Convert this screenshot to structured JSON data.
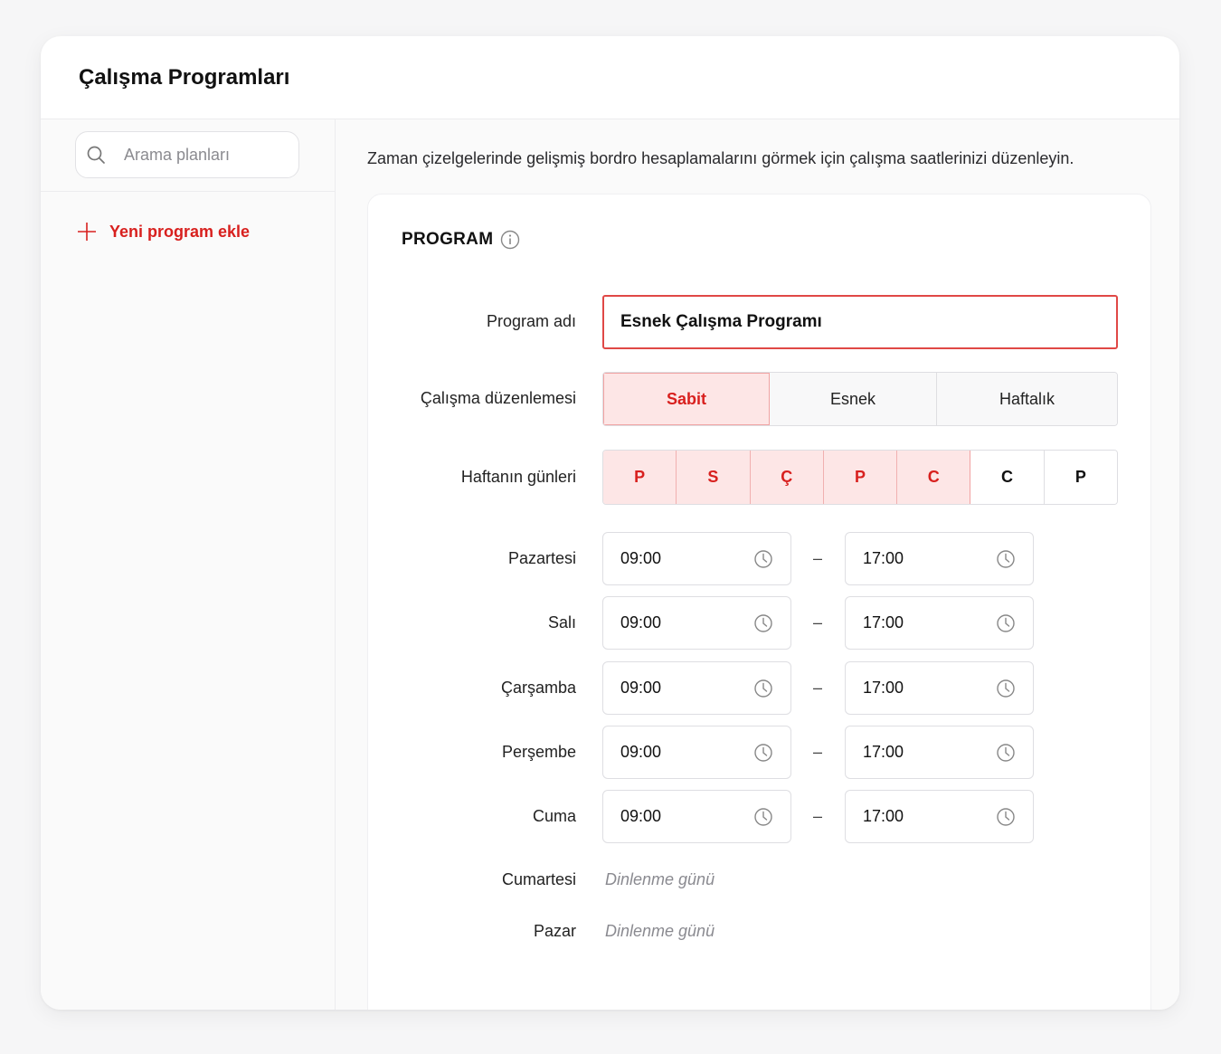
{
  "page": {
    "title": "Çalışma Programları"
  },
  "sidebar": {
    "search": {
      "placeholder": "Arama planları",
      "icon": "search-icon"
    },
    "add_program": {
      "label": "Yeni program ekle",
      "icon": "plus-icon"
    }
  },
  "main": {
    "description": "Zaman çizelgelerinde gelişmiş bordro hesaplamalarını görmek için çalışma saatlerinizi düzenleyin.",
    "section_title": "PROGRAM",
    "program_name": {
      "label": "Program adı",
      "value": "Esnek Çalışma Programı"
    },
    "arrangement": {
      "label": "Çalışma düzenlemesi",
      "options": [
        "Sabit",
        "Esnek",
        "Haftalık"
      ],
      "selected": "Sabit"
    },
    "weekdays": {
      "label": "Haftanın günleri",
      "days": [
        "P",
        "S",
        "Ç",
        "P",
        "C",
        "C",
        "P"
      ],
      "selected_count": 5
    },
    "schedule": [
      {
        "day": "Pazartesi",
        "start": "09:00",
        "end": "17:00"
      },
      {
        "day": "Salı",
        "start": "09:00",
        "end": "17:00"
      },
      {
        "day": "Çarşamba",
        "start": "09:00",
        "end": "17:00"
      },
      {
        "day": "Perşembe",
        "start": "09:00",
        "end": "17:00"
      },
      {
        "day": "Cuma",
        "start": "09:00",
        "end": "17:00"
      }
    ],
    "separator": "–",
    "rest_days": [
      {
        "day": "Cumartesi",
        "text": "Dinlenme günü"
      },
      {
        "day": "Pazar",
        "text": "Dinlenme günü"
      }
    ]
  },
  "colors": {
    "accent": "#d8201e",
    "accent_bg": "#fde6e6",
    "border": "#dedee2"
  }
}
